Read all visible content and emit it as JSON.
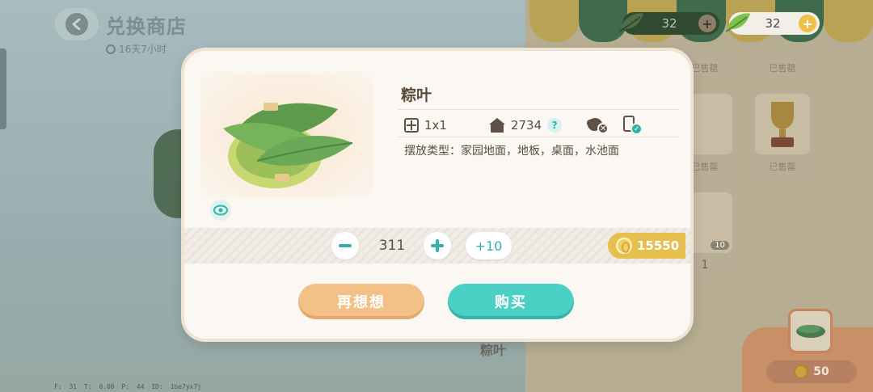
{
  "header": {
    "title": "兑换商店",
    "timer": "16天7小时"
  },
  "currencies": [
    {
      "value": "32"
    },
    {
      "value": "32"
    }
  ],
  "background": {
    "sold_label": "已售罄",
    "item_name": "粽叶",
    "corner_price": "50",
    "card_badge": "10",
    "card_count": "1"
  },
  "debug": "F: 31   T: 0.00   P: 44   ID: 1be7yx7j",
  "modal": {
    "item_name": "粽叶",
    "size": "1x1",
    "comfort": "2734",
    "help": "?",
    "placement": "摆放类型：家园地面，地板，桌面，水池面",
    "quantity": "311",
    "plus10_label": "+10",
    "price": "15550",
    "cancel_label": "再想想",
    "buy_label": "购买"
  },
  "colors": {
    "accent_teal": "#4ccfc4",
    "cancel_orange": "#f3c188",
    "price_gold": "#e6bf4f"
  }
}
